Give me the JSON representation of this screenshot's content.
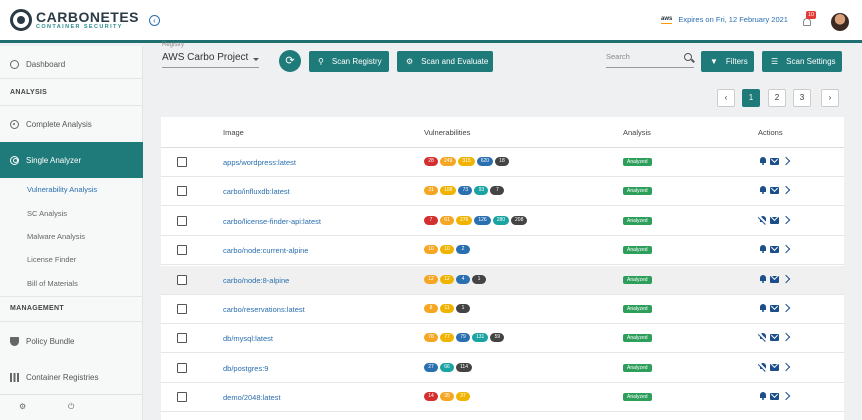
{
  "brand": {
    "title": "CARBONETES",
    "subtitle": "CONTAINER SECURITY"
  },
  "header": {
    "aws_label": "aws",
    "expiry": "Expires on Fri, 12 February 2021",
    "notification_count": "10"
  },
  "sidebar": {
    "dashboard": "Dashboard",
    "analysis_section": "ANALYSIS",
    "complete_analysis": "Complete Analysis",
    "single_analyzer": "Single Analyzer",
    "sub_items": [
      "Vulnerability Analysis",
      "SC Analysis",
      "Malware Analysis",
      "License Finder",
      "Bill of Materials"
    ],
    "management_section": "MANAGEMENT",
    "policy_bundle": "Policy Bundle",
    "container_registries": "Container Registries"
  },
  "toolbar": {
    "registry_label": "Registry",
    "registry_value": "AWS Carbo Project",
    "scan_registry": "Scan Registry",
    "scan_evaluate": "Scan and Evaluate",
    "search_placeholder": "Search",
    "filters": "Filters",
    "scan_settings": "Scan Settings"
  },
  "pagination": {
    "pages": [
      "1",
      "2",
      "3"
    ],
    "current": "1"
  },
  "table": {
    "headers": {
      "image": "Image",
      "vulnerabilities": "Vulnerabilities",
      "analysis": "Analysis",
      "actions": "Actions"
    },
    "rows": [
      {
        "image": "apps/wordpress:latest",
        "vulns": [
          {
            "v": "28",
            "c": "crit"
          },
          {
            "v": "249",
            "c": "high"
          },
          {
            "v": "315",
            "c": "med"
          },
          {
            "v": "620",
            "c": "low"
          },
          {
            "v": "18",
            "c": "neg"
          }
        ],
        "analysis": "Analyzed",
        "notify": "on"
      },
      {
        "image": "carbo/influxdb:latest",
        "vulns": [
          {
            "v": "31",
            "c": "high"
          },
          {
            "v": "108",
            "c": "med"
          },
          {
            "v": "73",
            "c": "low"
          },
          {
            "v": "93",
            "c": "info"
          },
          {
            "v": "7",
            "c": "neg"
          }
        ],
        "analysis": "Analyzed",
        "notify": "on"
      },
      {
        "image": "carbo/license-finder-api:latest",
        "vulns": [
          {
            "v": "7",
            "c": "crit"
          },
          {
            "v": "61",
            "c": "high"
          },
          {
            "v": "276",
            "c": "med"
          },
          {
            "v": "126",
            "c": "low"
          },
          {
            "v": "280",
            "c": "info"
          },
          {
            "v": "208",
            "c": "neg"
          }
        ],
        "analysis": "Analyzed",
        "notify": "off"
      },
      {
        "image": "carbo/node:current-alpine",
        "vulns": [
          {
            "v": "10",
            "c": "high"
          },
          {
            "v": "10",
            "c": "med"
          },
          {
            "v": "2",
            "c": "low"
          }
        ],
        "analysis": "Analyzed",
        "notify": "on"
      },
      {
        "image": "carbo/node:8-alpine",
        "vulns": [
          {
            "v": "12",
            "c": "high"
          },
          {
            "v": "12",
            "c": "med"
          },
          {
            "v": "4",
            "c": "low"
          },
          {
            "v": "1",
            "c": "neg"
          }
        ],
        "analysis": "Analyzed",
        "notify": "on"
      },
      {
        "image": "carbo/reservations:latest",
        "vulns": [
          {
            "v": "8",
            "c": "high"
          },
          {
            "v": "11",
            "c": "med"
          },
          {
            "v": "1",
            "c": "neg"
          }
        ],
        "analysis": "Analyzed",
        "notify": "on"
      },
      {
        "image": "db/mysql:latest",
        "vulns": [
          {
            "v": "78",
            "c": "high"
          },
          {
            "v": "77",
            "c": "med"
          },
          {
            "v": "79",
            "c": "low"
          },
          {
            "v": "131",
            "c": "info"
          },
          {
            "v": "59",
            "c": "neg"
          }
        ],
        "analysis": "Analyzed",
        "notify": "off"
      },
      {
        "image": "db/postgres:9",
        "vulns": [
          {
            "v": "27",
            "c": "low"
          },
          {
            "v": "66",
            "c": "info"
          },
          {
            "v": "114",
            "c": "neg"
          }
        ],
        "analysis": "Analyzed",
        "notify": "off"
      },
      {
        "image": "demo/2048:latest",
        "vulns": [
          {
            "v": "14",
            "c": "crit"
          },
          {
            "v": "35",
            "c": "high"
          },
          {
            "v": "37",
            "c": "med"
          }
        ],
        "analysis": "Analyzed",
        "notify": "on"
      }
    ]
  },
  "colors": {
    "accent": "#1f7a7a",
    "link": "#2a6fb0",
    "critical": "#d32f2f",
    "high": "#f5a623",
    "medium": "#f0b400",
    "low": "#2a6fb0",
    "info": "#1aa3a3",
    "negligible": "#444444",
    "analyzed": "#2e9e5b"
  }
}
